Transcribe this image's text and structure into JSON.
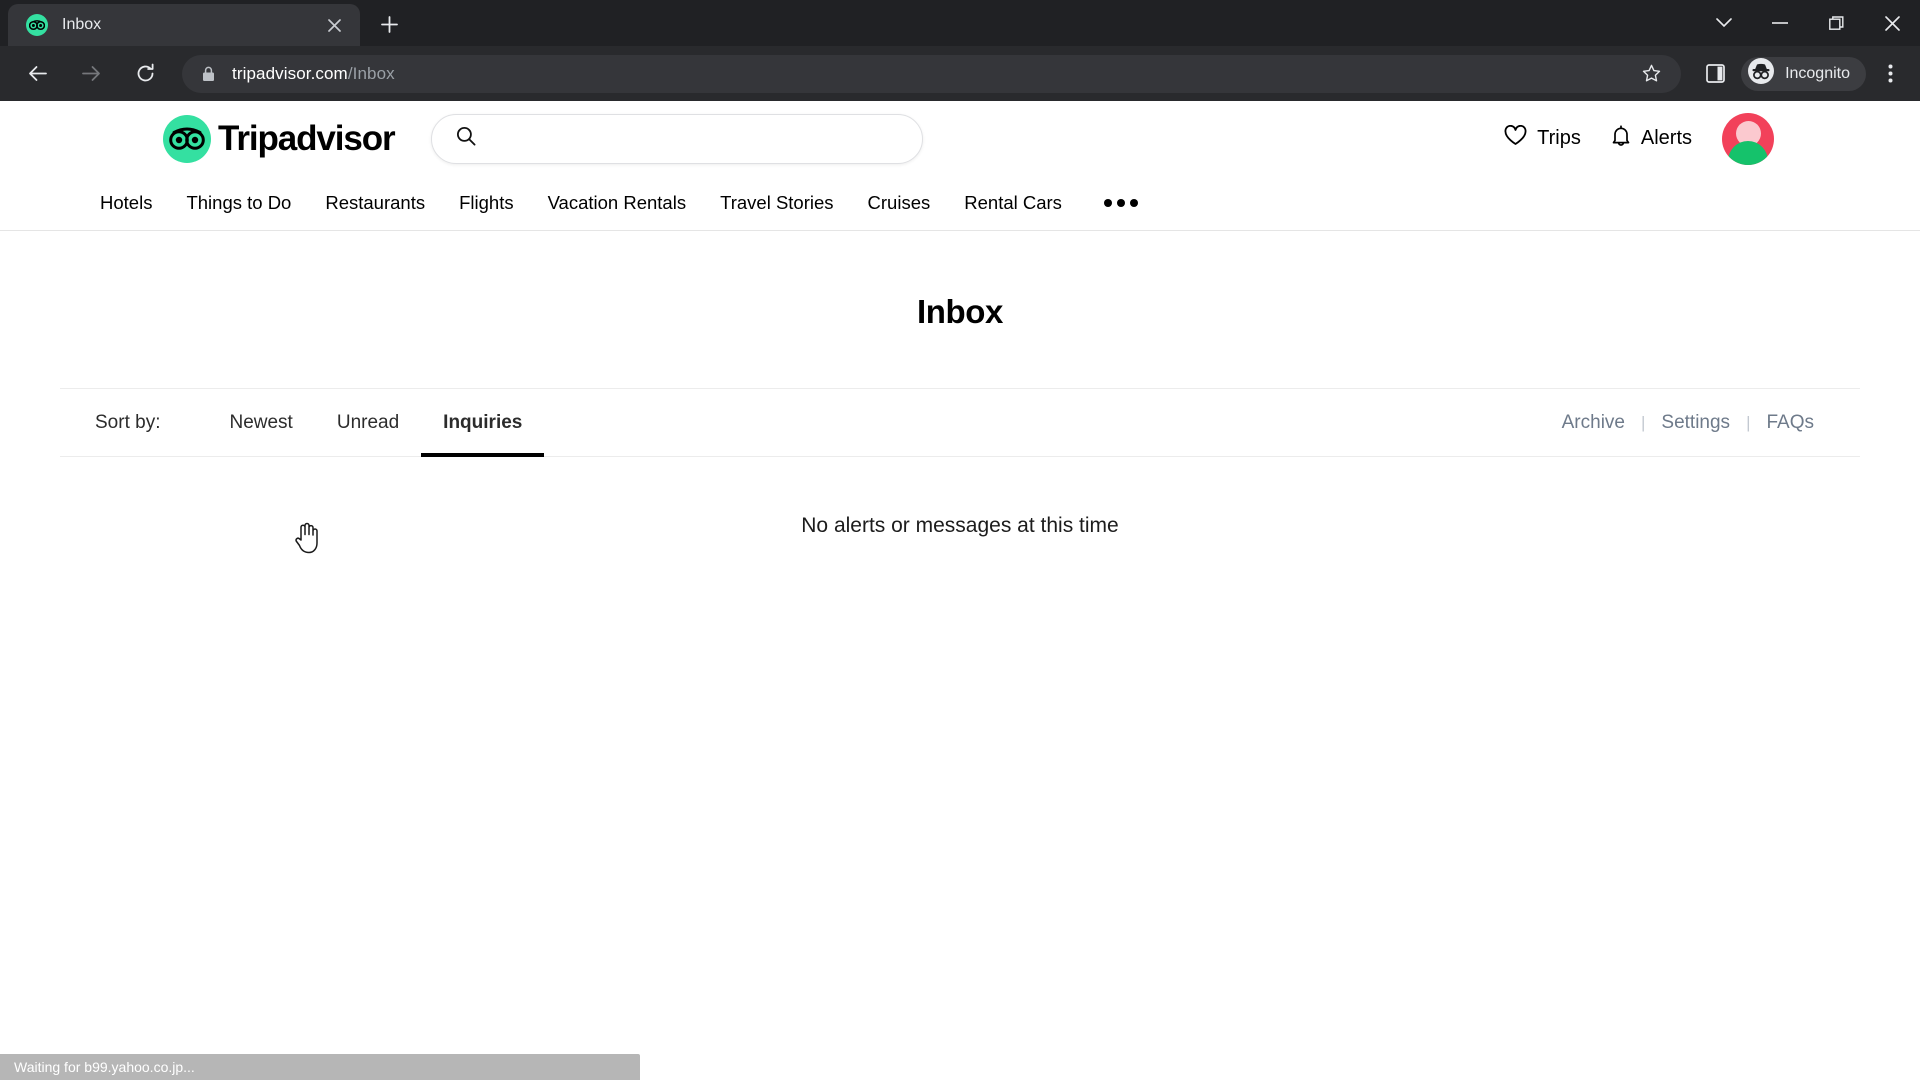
{
  "browser": {
    "tab": {
      "title": "Inbox",
      "favicon": "tripadvisor-owl-icon",
      "close_icon": "close-icon"
    },
    "new_tab_icon": "plus-icon",
    "window_controls": [
      {
        "name": "tab-search-chevron",
        "icon": "chevron-down-icon"
      },
      {
        "name": "minimize",
        "icon": "minimize-icon"
      },
      {
        "name": "maximize",
        "icon": "restore-icon"
      },
      {
        "name": "close",
        "icon": "close-icon"
      }
    ],
    "back_icon": "back-arrow-icon",
    "forward_icon": "forward-arrow-icon",
    "reload_icon": "reload-icon",
    "omnibox": {
      "lock_icon": "lock-icon",
      "url_domain": "tripadvisor.com",
      "url_path": "/Inbox",
      "full_url": "tripadvisor.com/Inbox"
    },
    "bookmark_icon": "star-icon",
    "side_panel_icon": "side-panel-icon",
    "incognito": {
      "label": "Incognito",
      "icon": "incognito-icon"
    },
    "menu_icon": "kebab-menu-icon",
    "status_text": "Waiting for b99.yahoo.co.jp..."
  },
  "site": {
    "logo_text": "Tripadvisor",
    "logo_icon": "tripadvisor-owl-icon",
    "search": {
      "value": "",
      "placeholder": "",
      "icon": "search-icon"
    },
    "header_actions": [
      {
        "label": "Trips",
        "icon": "heart-icon"
      },
      {
        "label": "Alerts",
        "icon": "bell-icon"
      }
    ],
    "avatar": "user-avatar",
    "nav": [
      "Hotels",
      "Things to Do",
      "Restaurants",
      "Flights",
      "Vacation Rentals",
      "Travel Stories",
      "Cruises",
      "Rental Cars"
    ],
    "nav_more_icon": "more-dots-icon"
  },
  "main": {
    "title": "Inbox",
    "sort_label": "Sort by:",
    "tabs": [
      {
        "label": "Newest",
        "active": false
      },
      {
        "label": "Unread",
        "active": false
      },
      {
        "label": "Inquiries",
        "active": true
      }
    ],
    "links": [
      {
        "label": "Archive"
      },
      {
        "label": "Settings"
      },
      {
        "label": "FAQs"
      }
    ],
    "separator": "|",
    "empty_message": "No alerts or messages at this time"
  },
  "colors": {
    "brand_green": "#34e0a1",
    "chrome_dark": "#202124",
    "toolbar_dark": "#292a2d",
    "link_gray_blue": "#6e7a8a",
    "avatar_red": "#f2415a",
    "avatar_green": "#15c26b",
    "status_bg": "#b6b6b6"
  }
}
